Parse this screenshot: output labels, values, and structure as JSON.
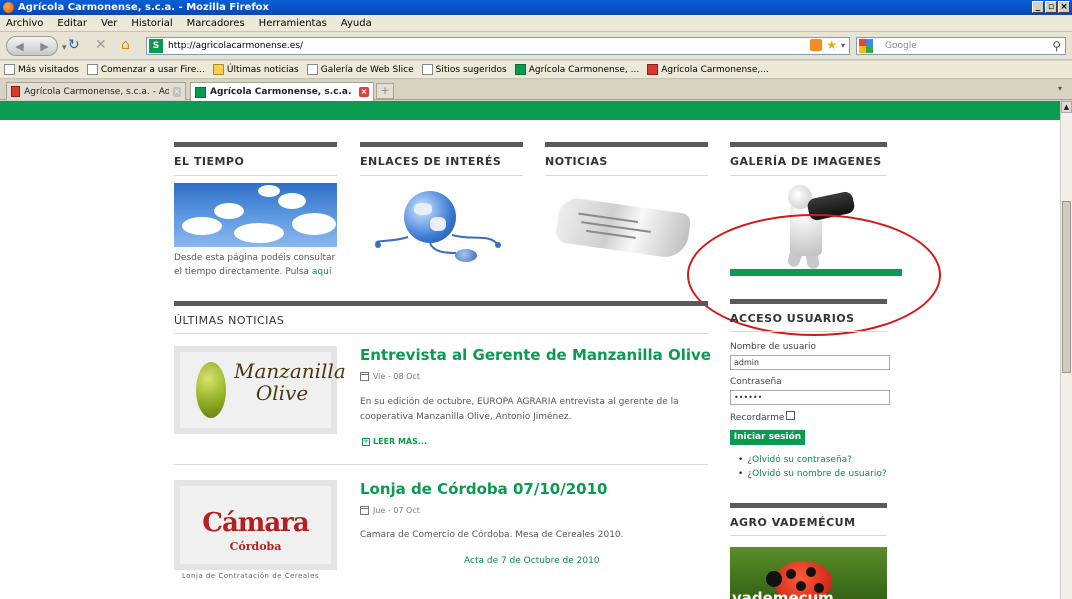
{
  "window": {
    "title": "Agrícola Carmonense, s.c.a. - Mozilla Firefox",
    "controls": [
      "_",
      "▫",
      "×"
    ]
  },
  "menu": [
    "Archivo",
    "Editar",
    "Ver",
    "Historial",
    "Marcadores",
    "Herramientas",
    "Ayuda"
  ],
  "nav": {
    "url": "http://agricolacarmonense.es/",
    "search_placeholder": "Google"
  },
  "bookmarks": [
    {
      "label": "Más visitados",
      "icon": "page-icon"
    },
    {
      "label": "Comenzar a usar Fire...",
      "icon": "page-icon"
    },
    {
      "label": "Últimas noticias",
      "icon": "folder-icon"
    },
    {
      "label": "Galería de Web Slice",
      "icon": "page-icon"
    },
    {
      "label": "Sitios sugeridos",
      "icon": "page-icon"
    },
    {
      "label": "Agrícola Carmonense, ...",
      "icon": "site-icon"
    },
    {
      "label": "Agrícola Carmonense,...",
      "icon": "joomla-icon"
    }
  ],
  "tabs": [
    {
      "label": "Agrícola Carmonense, s.c.a. - Administ...",
      "active": false
    },
    {
      "label": "Agrícola Carmonense, s.c.a.",
      "active": true
    }
  ],
  "sections": {
    "tiempo": "EL TIEMPO",
    "enlaces": "ENLACES DE INTERÉS",
    "noticias": "NOTICIAS",
    "galeria": "GALERÍA DE IMAGENES",
    "ultimas": "ÚLTIMAS NOTICIAS",
    "acceso": "ACCESO USUARIOS",
    "agro": "AGRO VADEMÉCUM"
  },
  "weather": {
    "text": "Desde esta página podéis consultar el tiempo directamente. Pulsa",
    "link": "aquí"
  },
  "news": [
    {
      "title": "Entrevista al Gerente de Manzanilla Olive",
      "date": "Vie - 08 Oct",
      "body": "En su edición de octubre, EUROPA AGRARIA entrevista al gerente de la cooperativa Manzanilla Olive, Antonio Jiménez.",
      "readmore": "LEER MÁS...",
      "thumb_text": "Manzanilla Olive"
    },
    {
      "title": "Lonja de Córdoba 07/10/2010",
      "date": "Jue - 07 Oct",
      "body": "Camara de Comercio de Córdoba. Mesa de Cereales 2010.",
      "link": "Acta de 7 de Octubre de 2010",
      "thumb_text": "Cámara",
      "thumb_sub": "Córdoba",
      "caption": "Lonja de Contratación de Cereales"
    }
  ],
  "login": {
    "username_label": "Nombre de usuario",
    "username_value": "admin",
    "password_label": "Contraseña",
    "password_value": "••••••",
    "remember_label": "Recordarme",
    "submit": "Iniciar sesión",
    "forgot_password": "¿Olvidó su contraseña?",
    "forgot_username": "¿Olvidó su nombre de usuario?"
  },
  "vademecum_text": "vademecum",
  "colors": {
    "brand_green": "#0a9a50",
    "annotation_red": "#d21818"
  }
}
